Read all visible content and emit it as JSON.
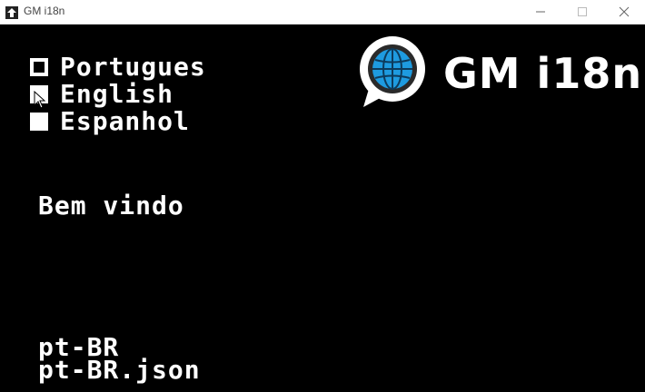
{
  "window": {
    "title": "GM i18n",
    "app_icon": "gamemaker-icon",
    "controls": [
      "minimize-icon",
      "maximize-icon",
      "close-icon"
    ]
  },
  "language_menu": {
    "options": [
      {
        "label": "Portugues",
        "selected": true
      },
      {
        "label": "English",
        "selected": false
      },
      {
        "label": "Espanhol",
        "selected": false
      }
    ]
  },
  "logo": {
    "text": "GM i18n",
    "icon": "globe-chat-bubble-icon",
    "accent": "#1e9be0"
  },
  "greeting": "Bem vindo",
  "locale": {
    "code": "pt-BR",
    "file": "pt-BR.json"
  },
  "colors": {
    "background": "#000000",
    "text": "#ffffff",
    "titlebar": "#ffffff"
  }
}
